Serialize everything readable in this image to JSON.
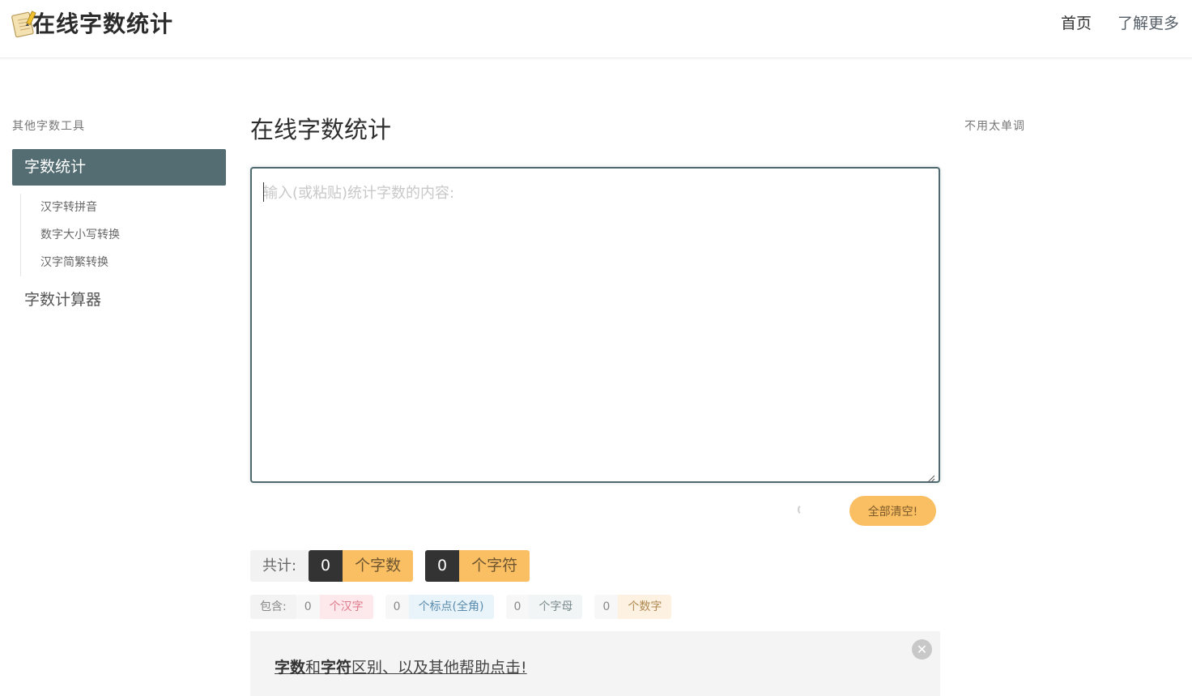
{
  "header": {
    "logo_text": "在线字数统计",
    "nav": {
      "home": "首页",
      "about": "了解更多"
    }
  },
  "sidebar": {
    "heading": "其他字数工具",
    "active_item": "字数统计",
    "sub_items": [
      {
        "label": "汉字转拼音"
      },
      {
        "label": "数字大小写转换"
      },
      {
        "label": "汉字简繁转换"
      }
    ],
    "second_item": "字数计算器"
  },
  "main": {
    "title": "在线字数统计",
    "textarea": {
      "placeholder": "输入(或粘贴)统计字数的内容:",
      "value": ""
    },
    "clear_button": "全部清空!",
    "totals": {
      "label": "共计:",
      "word_count": "0",
      "word_unit": "个字数",
      "char_count": "0",
      "char_unit": "个字符"
    },
    "breakdown": {
      "label": "包含:",
      "items": [
        {
          "count": "0",
          "unit": "个汉字",
          "color": "#fde8ec",
          "text_color": "#e07a8a"
        },
        {
          "count": "0",
          "unit": "个标点(全角)",
          "color": "#e8f3fa",
          "text_color": "#5b8cae"
        },
        {
          "count": "0",
          "unit": "个字母",
          "color": "#f2f5f6",
          "text_color": "#7b8a8e"
        },
        {
          "count": "0",
          "unit": "个数字",
          "color": "#fdf2e2",
          "text_color": "#b08850"
        }
      ]
    },
    "help": {
      "part1": "字数",
      "part2": "和",
      "part3": "字符",
      "part4": "区别、以及其他帮助点击!"
    }
  },
  "right": {
    "note": "不用太单调"
  },
  "colors": {
    "primary": "#536d72",
    "accent": "#fbbf63",
    "dark": "#333333"
  }
}
